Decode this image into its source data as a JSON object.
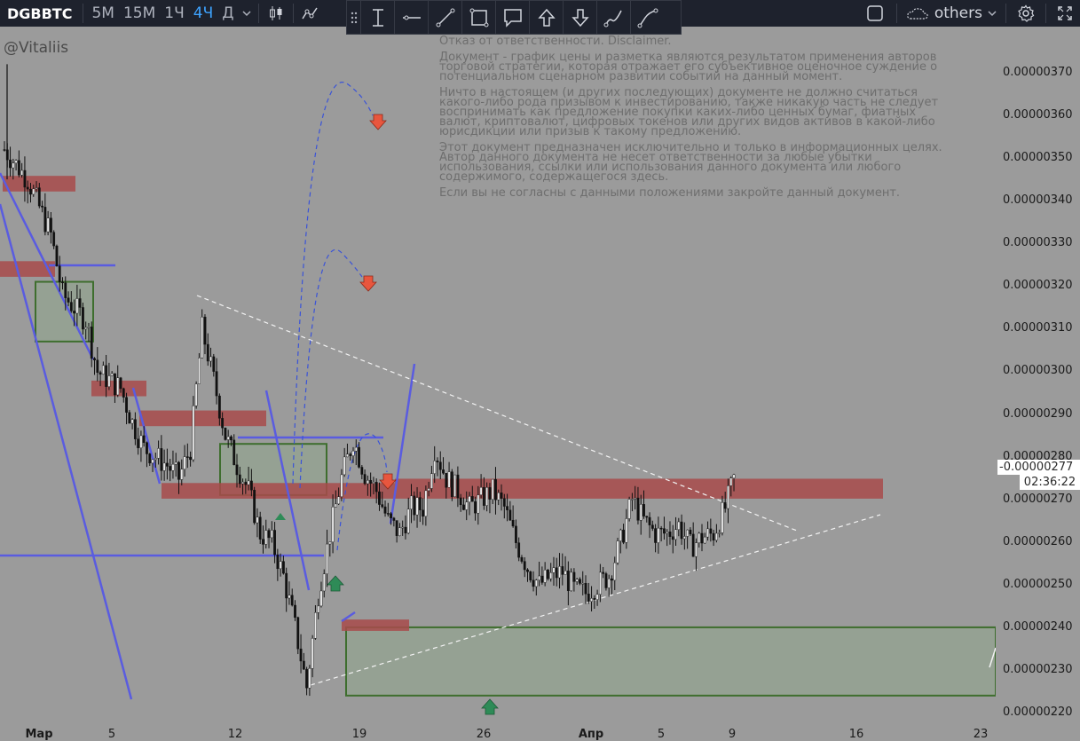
{
  "toolbar": {
    "symbol": "DGBBTC",
    "timeframes": [
      {
        "label": "5M",
        "active": false
      },
      {
        "label": "15M",
        "active": false
      },
      {
        "label": "1Ч",
        "active": false
      },
      {
        "label": "4Ч",
        "active": true
      },
      {
        "label": "Д",
        "active": false
      }
    ],
    "chart_type_icon": "candles-icon",
    "indicators_icon": "indicators-icon",
    "layout_name": "others",
    "settings_icon": "gear-icon",
    "fullscreen_icon": "fullscreen-icon"
  },
  "drawing_tools": [
    {
      "name": "drag-handle-icon"
    },
    {
      "name": "text-cursor-icon"
    },
    {
      "name": "horizontal-ray-icon"
    },
    {
      "name": "trend-line-icon"
    },
    {
      "name": "rectangle-icon"
    },
    {
      "name": "callout-icon"
    },
    {
      "name": "arrow-up-icon"
    },
    {
      "name": "arrow-down-icon"
    },
    {
      "name": "brush-icon"
    },
    {
      "name": "path-icon"
    }
  ],
  "watermark": "@Vitaliis",
  "disclaimer": {
    "title": "Отказ от ответственности. Disclaimer.",
    "paragraphs": [
      "Документ - график цены и разметка являются результатом применения авторов торговой стратегии, которая отражает его субъективное оценочное суждение о потенциальном сценарном развитии событий на данный момент.",
      "Ничто в настоящем (и других последующих) документе не должно считаться какого-либо рода призывом к инвестированию, также никакую часть не следует воспринимать как предложение покупки каких-либо ценных бумаг, фиатных валют, криптовалют, цифровых токенов или других видов активов в какой-либо юрисдикции или призыв к такому предложению.",
      "Этот документ предназначен исключительно и только в информационных целях. Автор данного документа не несет ответственности за любые убытки использования, ссылки или использования данного документа или любого содержимого, содержащегося здесь.",
      "Если вы не согласны с данными положениями закройте данный документ."
    ]
  },
  "current_price": {
    "value": "0.00000277",
    "timer": "02:36:22"
  },
  "colors": {
    "background": "#9b9b9b",
    "toolbar": "#1e222d",
    "active_tf": "#3ea3ff",
    "zone_red": "#a84b4b",
    "zone_green": "#3e6e2e",
    "trend_blue": "#5a5ce0",
    "arrow_red": "#e8563e",
    "arrow_green": "#2e8b57"
  },
  "chart_data": {
    "type": "candlestick",
    "symbol": "DGBBTC",
    "interval": "4H",
    "y_ticks": [
      3.7e-06,
      3.6e-06,
      3.5e-06,
      3.4e-06,
      3.3e-06,
      3.2e-06,
      3.1e-06,
      3e-06,
      2.9e-06,
      2.8e-06,
      2.7e-06,
      2.6e-06,
      2.5e-06,
      2.4e-06,
      2.3e-06,
      2.2e-06
    ],
    "y_tick_labels": [
      "0.00000370",
      "0.00000360",
      "0.00000350",
      "0.00000340",
      "0.00000330",
      "0.00000320",
      "0.00000310",
      "0.00000300",
      "0.00000290",
      "0.00000280",
      "0.00000270",
      "0.00000260",
      "0.00000250",
      "0.00000240",
      "0.00000230",
      "0.00000220"
    ],
    "ylim": [
      2.19e-06,
      3.74e-06
    ],
    "x_ticks": [
      "Мар",
      "5",
      "12",
      "19",
      "26",
      "Апр",
      "5",
      "9",
      "16",
      "23"
    ],
    "close_path": [
      [
        0,
        3.52e-06
      ],
      [
        2,
        3.45e-06
      ],
      [
        4,
        3.32e-06
      ],
      [
        5,
        3.18e-06
      ],
      [
        7,
        3.12e-06
      ],
      [
        8,
        3e-06
      ],
      [
        10,
        2.96e-06
      ],
      [
        11,
        2.88e-06
      ],
      [
        12,
        2.82e-06
      ],
      [
        13,
        2.8e-06
      ],
      [
        14,
        2.78e-06
      ],
      [
        15,
        2.75e-06
      ],
      [
        16,
        2.82e-06
      ],
      [
        17,
        3.1e-06
      ],
      [
        18,
        2.98e-06
      ],
      [
        19,
        2.85e-06
      ],
      [
        20,
        2.78e-06
      ],
      [
        21,
        2.72e-06
      ],
      [
        22,
        2.62e-06
      ],
      [
        23,
        2.6e-06
      ],
      [
        24,
        2.52e-06
      ],
      [
        25,
        2.4e-06
      ],
      [
        26,
        2.26e-06
      ],
      [
        27,
        2.48e-06
      ],
      [
        28,
        2.62e-06
      ],
      [
        29,
        2.75e-06
      ],
      [
        30,
        2.84e-06
      ],
      [
        31,
        2.76e-06
      ],
      [
        32,
        2.72e-06
      ],
      [
        33,
        2.65e-06
      ],
      [
        34,
        2.62e-06
      ],
      [
        35,
        2.68e-06
      ],
      [
        36,
        2.68e-06
      ],
      [
        37,
        2.82e-06
      ],
      [
        38,
        2.75e-06
      ],
      [
        39,
        2.72e-06
      ],
      [
        40,
        2.68e-06
      ],
      [
        41,
        2.7e-06
      ],
      [
        42,
        2.72e-06
      ],
      [
        43,
        2.68e-06
      ],
      [
        44,
        2.6e-06
      ],
      [
        45,
        2.54e-06
      ],
      [
        46,
        2.5e-06
      ],
      [
        47,
        2.52e-06
      ],
      [
        48,
        2.53e-06
      ],
      [
        49,
        2.49e-06
      ],
      [
        50,
        2.48e-06
      ],
      [
        51,
        2.5e-06
      ],
      [
        52,
        2.52e-06
      ],
      [
        53,
        2.6e-06
      ],
      [
        54,
        2.7e-06
      ],
      [
        55,
        2.65e-06
      ],
      [
        56,
        2.62e-06
      ],
      [
        57,
        2.62e-06
      ],
      [
        58,
        2.64e-06
      ],
      [
        59,
        2.59e-06
      ],
      [
        60,
        2.61e-06
      ],
      [
        61,
        2.62e-06
      ],
      [
        62,
        2.68e-06
      ],
      [
        63,
        2.77e-06
      ]
    ],
    "resistance_zones": [
      {
        "y": [
          3.43e-06,
          3.45e-06
        ]
      },
      {
        "y": [
          3.23e-06,
          3.25e-06
        ]
      },
      {
        "y": [
          2.95e-06,
          2.97e-06
        ]
      },
      {
        "y": [
          2.88e-06,
          2.9e-06
        ]
      },
      {
        "y": [
          2.71e-06,
          2.73e-06
        ]
      },
      {
        "y": [
          2.71e-06,
          2.74e-06
        ]
      },
      {
        "y": [
          2.4e-06,
          2.41e-06
        ]
      }
    ],
    "demand_zones": [
      {
        "y": [
          3.07e-06,
          3.21e-06
        ]
      },
      {
        "y": [
          2.71e-06,
          2.83e-06
        ]
      },
      {
        "y": [
          2.24e-06,
          2.4e-06
        ]
      }
    ],
    "current_price": 2.77e-06
  }
}
